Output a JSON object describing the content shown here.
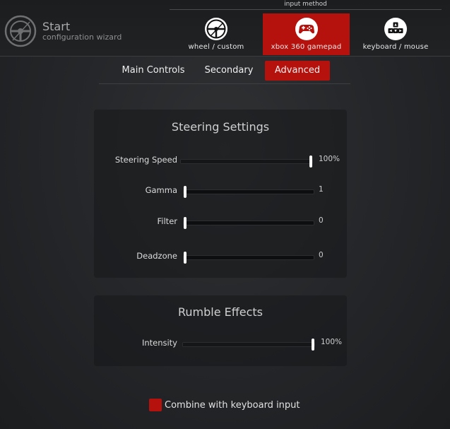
{
  "header": {
    "title": "Start",
    "subtitle": "configuration wizard",
    "input_method_label": "input method",
    "methods": [
      {
        "label": "wheel / custom",
        "icon": "steering-wheel-icon",
        "selected": false
      },
      {
        "label": "xbox 360 gamepad",
        "icon": "gamepad-icon",
        "selected": true
      },
      {
        "label": "keyboard / mouse",
        "icon": "keyboard-keys-icon",
        "selected": false
      }
    ]
  },
  "tabs": [
    {
      "label": "Main Controls",
      "active": false
    },
    {
      "label": "Secondary",
      "active": false
    },
    {
      "label": "Advanced",
      "active": true
    }
  ],
  "steering": {
    "title": "Steering Settings",
    "sliders": [
      {
        "label": "Steering Speed",
        "value": "100%",
        "fraction": 1.0
      },
      {
        "label": "Gamma",
        "value": "1",
        "fraction": 0.0
      },
      {
        "label": "Filter",
        "value": "0",
        "fraction": 0.0
      },
      {
        "label": "Deadzone",
        "value": "0",
        "fraction": 0.0
      }
    ]
  },
  "rumble": {
    "title": "Rumble Effects",
    "sliders": [
      {
        "label": "Intensity",
        "value": "100%",
        "fraction": 1.0
      }
    ]
  },
  "combine": {
    "label": "Combine with keyboard input",
    "checked": true
  },
  "colors": {
    "accent": "#b5120e",
    "background": "#25272a"
  }
}
